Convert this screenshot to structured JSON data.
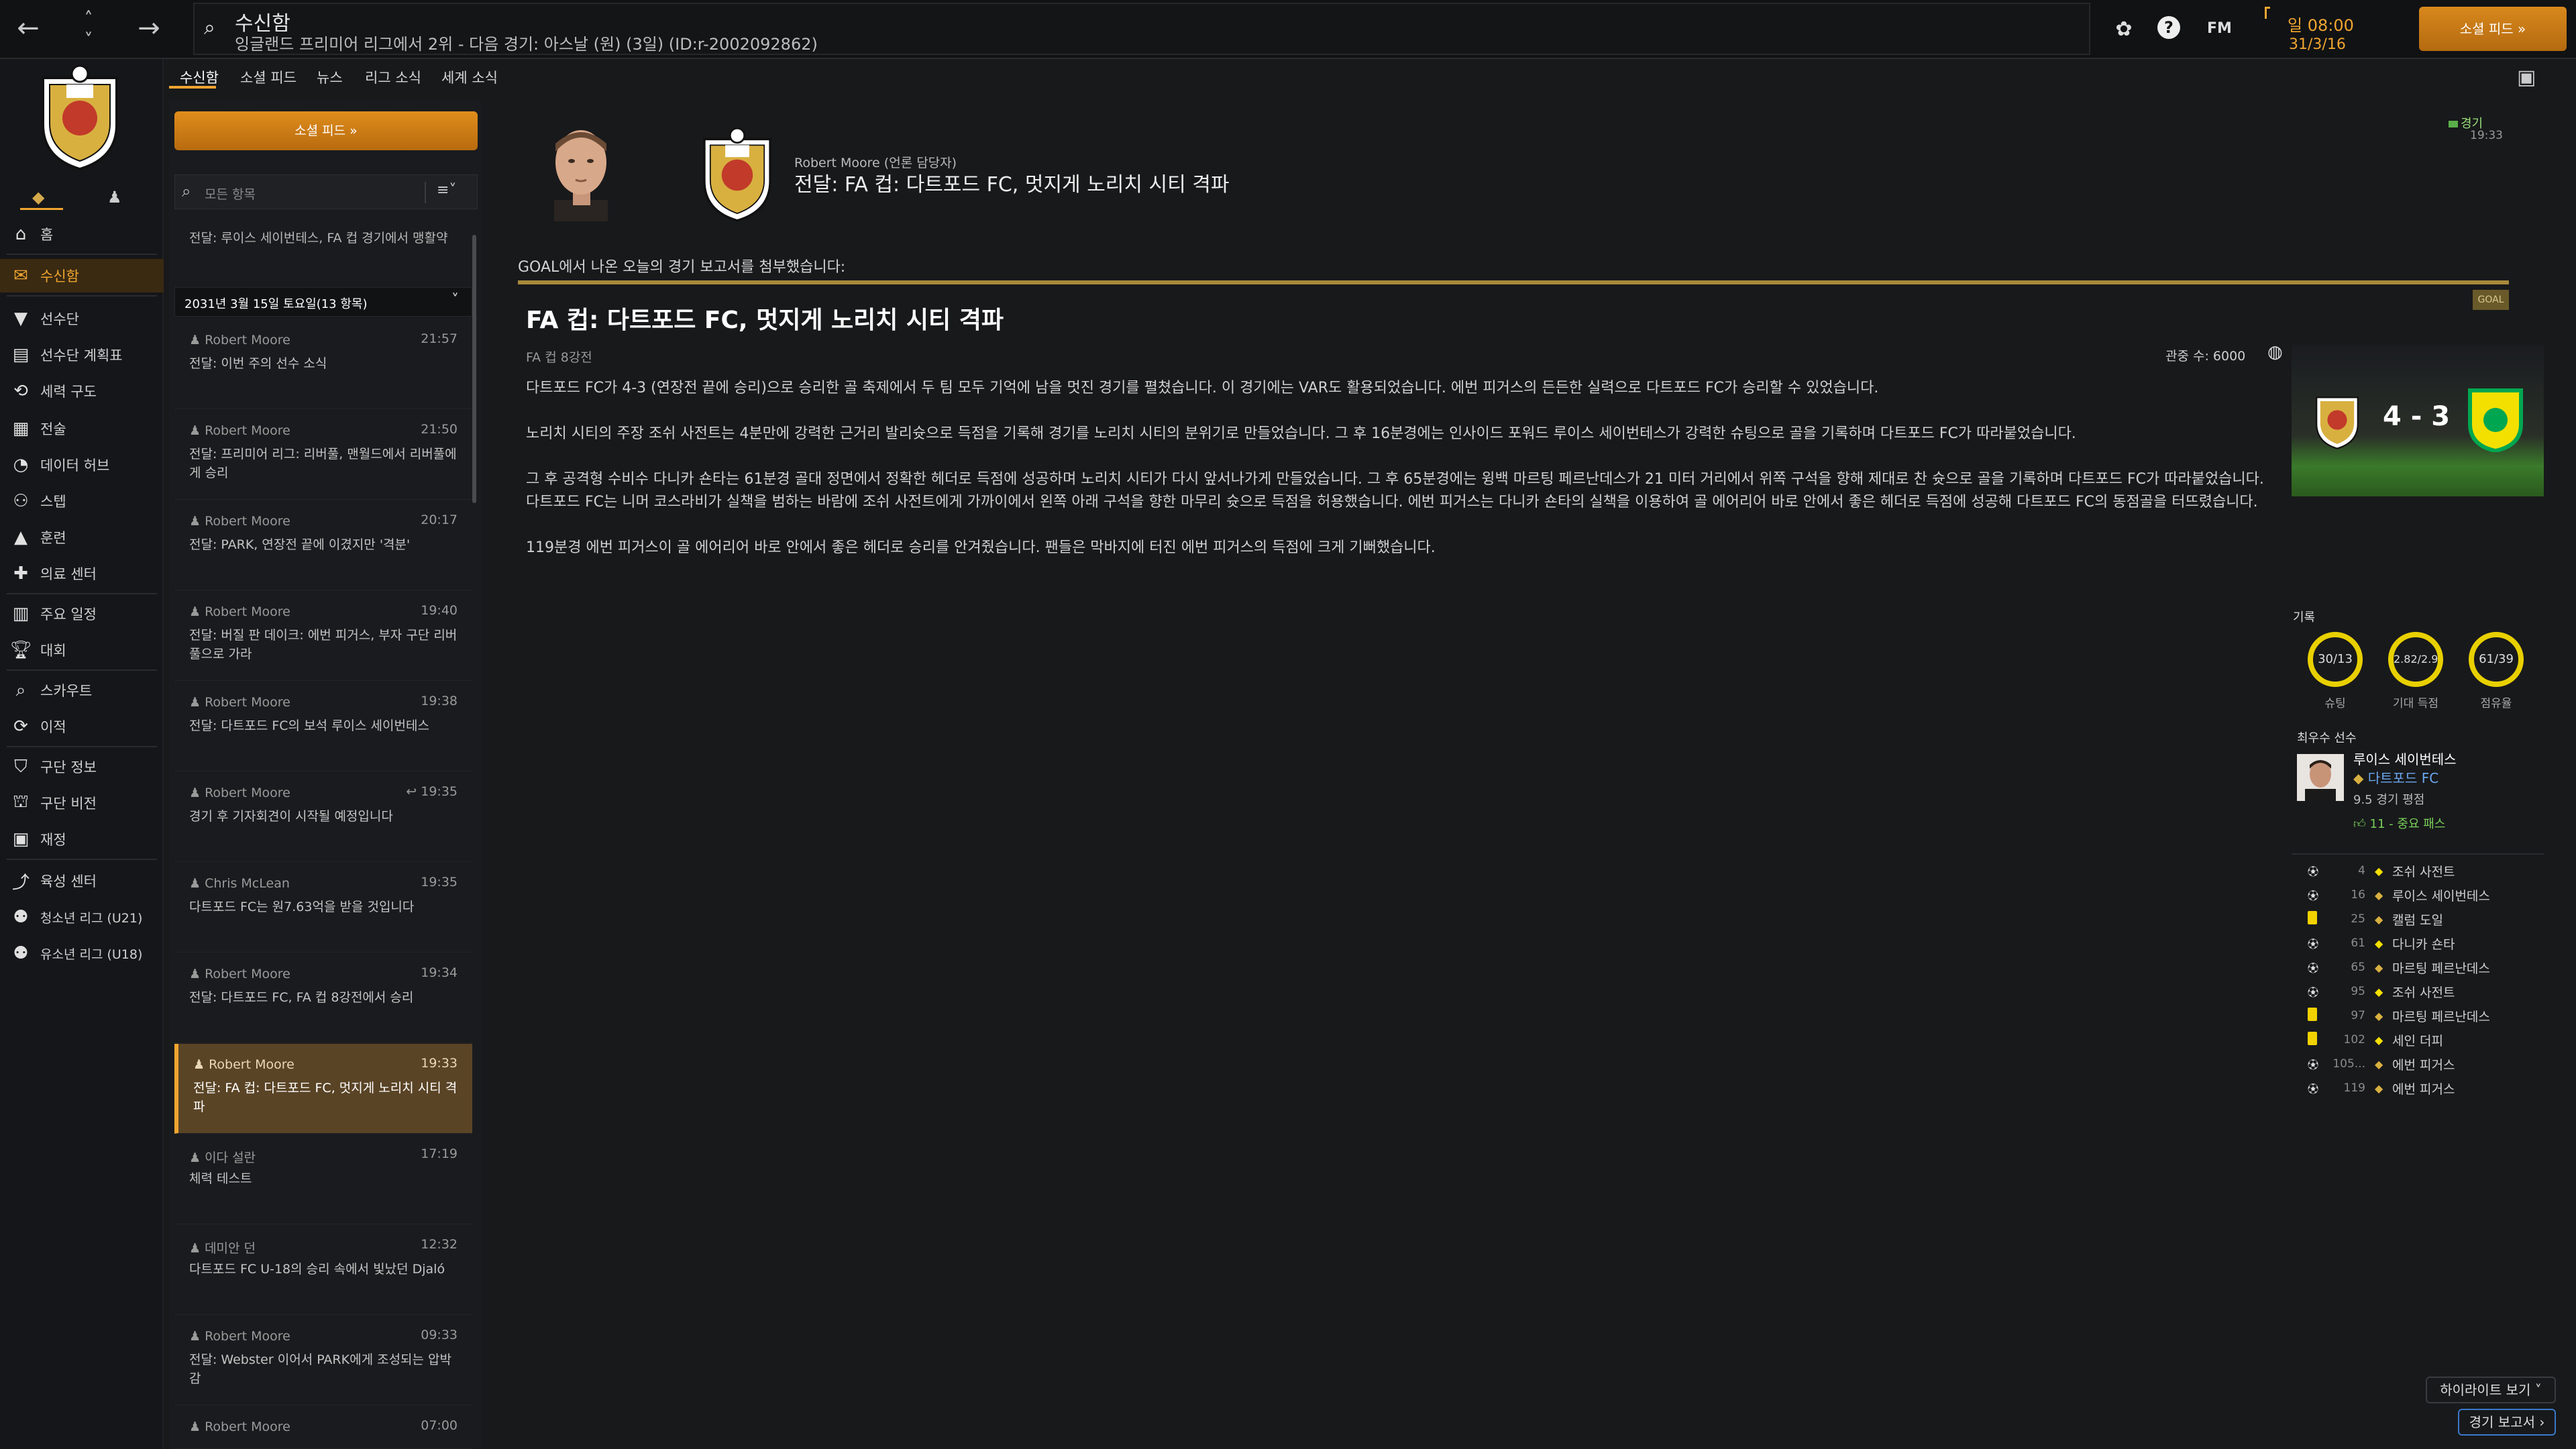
{
  "topbar": {
    "title": "수신함",
    "subtitle": "잉글랜드 프리미어 리그에서 2위 - 다음 경기: 아스날 (원) (3일) (ID:r-2002092862)",
    "fm_label": "FM",
    "day_time": "일 08:00",
    "date": "31/3/16",
    "social_button": "소셜 피드"
  },
  "leftnav": {
    "items": [
      {
        "label": "홈",
        "icon": "home-icon"
      },
      {
        "label": "수신함",
        "icon": "inbox-icon"
      },
      {
        "label": "선수단",
        "icon": "shirt-icon"
      },
      {
        "label": "선수단 계획표",
        "icon": "planner-icon"
      },
      {
        "label": "세력 구도",
        "icon": "dynamics-icon"
      },
      {
        "label": "전술",
        "icon": "tactics-icon"
      },
      {
        "label": "데이터 허브",
        "icon": "data-hub-icon"
      },
      {
        "label": "스텝",
        "icon": "staff-icon"
      },
      {
        "label": "훈련",
        "icon": "training-icon"
      },
      {
        "label": "의료 센터",
        "icon": "medical-icon"
      },
      {
        "label": "주요 일정",
        "icon": "calendar-icon"
      },
      {
        "label": "대회",
        "icon": "trophy-icon"
      },
      {
        "label": "스카우트",
        "icon": "scouting-icon"
      },
      {
        "label": "이적",
        "icon": "transfer-icon"
      },
      {
        "label": "구단 정보",
        "icon": "club-info-icon"
      },
      {
        "label": "구단 비전",
        "icon": "club-vision-icon"
      },
      {
        "label": "재정",
        "icon": "finance-icon"
      },
      {
        "label": "육성 센터",
        "icon": "development-icon"
      },
      {
        "label": "청소년 리그 (U21)",
        "icon": "u21-icon"
      },
      {
        "label": "유소년 리그 (U18)",
        "icon": "u18-icon"
      }
    ]
  },
  "tabs": [
    "수신함",
    "소셜 피드",
    "뉴스",
    "리그 소식",
    "세계 소식"
  ],
  "inbox": {
    "social_button": "소셜 피드",
    "search_placeholder": "모든 항목",
    "pinned": "전달: 루이스 세이번테스, FA 컵 경기에서 맹활약",
    "group_header": "2031년 3월 15일 토요일(13 항목)",
    "messages": [
      {
        "sender": "Robert Moore",
        "time": "21:57",
        "subject": "전달: 이번 주의 선수 소식"
      },
      {
        "sender": "Robert Moore",
        "time": "21:50",
        "subject": "전달: 프리미어 리그: 리버풀, 맨월드에서 리버풀에게 승리"
      },
      {
        "sender": "Robert Moore",
        "time": "20:17",
        "subject": "전달: PARK, 연장전 끝에 이겼지만 '격분'"
      },
      {
        "sender": "Robert Moore",
        "time": "19:40",
        "subject": "전달: 버질 판 데이크: 에번 피거스, 부자 구단 리버풀으로 가라"
      },
      {
        "sender": "Robert Moore",
        "time": "19:38",
        "subject": "전달: 다트포드 FC의 보석 루이스 세이번테스"
      },
      {
        "sender": "Robert Moore",
        "time": "19:35",
        "subject": "경기 후 기자회견이 시작될 예정입니다"
      },
      {
        "sender": "Chris McLean",
        "time": "19:35",
        "subject": "다트포드 FC는 원7.63억을 받을 것입니다"
      },
      {
        "sender": "Robert Moore",
        "time": "19:34",
        "subject": "전달: 다트포드 FC, FA 컵 8강전에서 승리"
      },
      {
        "sender": "Robert Moore",
        "time": "19:33",
        "subject": "전달: FA 컵: 다트포드 FC, 멋지게 노리치 시티 격파"
      },
      {
        "sender": "이다 설란",
        "time": "17:19",
        "subject": "체력 테스트"
      },
      {
        "sender": "데미안 던",
        "time": "12:32",
        "subject": "다트포드 FC U-18의 승리 속에서 빛났던 Djaló"
      },
      {
        "sender": "Robert Moore",
        "time": "09:33",
        "subject": "전달: Webster 이어서 PARK에게 조성되는 압박감"
      },
      {
        "sender": "Robert Moore",
        "time": "07:00",
        "subject": ""
      }
    ]
  },
  "message": {
    "from": "Robert Moore",
    "from_role": "(언론 담당자)",
    "subject": "전달: FA 컵: 다트포드 FC, 멋지게 노리치 시티 격파",
    "intro": "GOAL에서 나온 오늘의 경기 보고서를 첨부했습니다:",
    "status": "경기",
    "status_time": "19:33",
    "source_badge": "GOAL",
    "report_title": "FA 컵: 다트포드 FC, 멋지게 노리치 시티 격파",
    "competition": "FA 컵 8강전",
    "attendance": "관중 수: 6000",
    "paragraphs": [
      "다트포드 FC가 4-3 (연장전 끝에 승리)으로 승리한 골 축제에서 두 팀 모두 기억에 남을 멋진 경기를 펼쳤습니다. 이 경기에는 VAR도 활용되었습니다. 에번 피거스의 든든한 실력으로 다트포드 FC가 승리할 수 있었습니다.",
      "노리치 시티의 주장 조쉬 사전트는 4분만에 강력한 근거리 발리슛으로 득점을 기록해 경기를 노리치 시티의 분위기로 만들었습니다. 그 후 16분경에는 인사이드 포워드 루이스 세이번테스가 강력한 슈팅으로 골을 기록하며 다트포드 FC가 따라붙었습니다.",
      "그 후 공격형 수비수 다니카 숀타는 61분경 골대 정면에서 정확한 헤더로 득점에 성공하며 노리치 시티가 다시 앞서나가게 만들었습니다. 그 후 65분경에는 윙백 마르팅 페르난데스가 21 미터 거리에서 위쪽 구석을 향해 제대로 찬 슛으로 골을 기록하며 다트포드 FC가 따라붙었습니다. 다트포드 FC는 니머 코스라비가 실책을 범하는 바람에 조쉬 사전트에게 가까이에서 왼쪽 아래 구석을 향한 마무리 슛으로 득점을 허용했습니다. 에번 피거스는 다니카 숀타의 실책을 이용하여 골 에어리어 바로 안에서 좋은 헤더로 득점에 성공해 다트포드 FC의 동점골을 터뜨렸습니다.",
      "119분경 에번 피거스이 골 에어리어 바로 안에서 좋은 헤더로 승리를 안겨줬습니다. 팬들은 막바지에 터진 에번 피거스의 득점에 크게 기뻐했습니다."
    ]
  },
  "match": {
    "score": "4 - 3",
    "stats_label": "기록",
    "stats": [
      {
        "value": "30/13",
        "label": "슈팅"
      },
      {
        "value": "2.82/2.9",
        "label": "기대 득점"
      },
      {
        "value": "61/39",
        "label": "점유율"
      }
    ],
    "motm_label": "최우수 선수",
    "motm_name": "루이스 세이번테스",
    "motm_club": "다트포드 FC",
    "motm_rating": "9.5 경기 평점",
    "motm_note": "11 - 중요 패스",
    "events": [
      {
        "minute": "4",
        "type": "goal",
        "team": "norwich",
        "player": "조쉬 사전트"
      },
      {
        "minute": "16",
        "type": "goal",
        "team": "dartford",
        "player": "루이스 세이번테스"
      },
      {
        "minute": "25",
        "type": "yellow",
        "team": "dartford",
        "player": "캘럼 도일"
      },
      {
        "minute": "61",
        "type": "goal",
        "team": "norwich",
        "player": "다니카 숀타"
      },
      {
        "minute": "65",
        "type": "goal",
        "team": "dartford",
        "player": "마르팅 페르난데스"
      },
      {
        "minute": "95",
        "type": "goal",
        "team": "norwich",
        "player": "조쉬 사전트"
      },
      {
        "minute": "97",
        "type": "yellow",
        "team": "dartford",
        "player": "마르팅 페르난데스"
      },
      {
        "minute": "102",
        "type": "yellow",
        "team": "norwich",
        "player": "세인 더피"
      },
      {
        "minute": "105...",
        "type": "goal",
        "team": "dartford",
        "player": "에번 피거스"
      },
      {
        "minute": "119",
        "type": "goal",
        "team": "dartford",
        "player": "에번 피거스"
      }
    ],
    "highlights_button": "하이라이트 보기",
    "report_button": "경기 보고서"
  },
  "colors": {
    "accent": "#f0a530",
    "selected": "#5a4426",
    "yellow_card": "#f1d200",
    "norwich_yellow": "#f4e000",
    "norwich_green": "#00a650"
  }
}
